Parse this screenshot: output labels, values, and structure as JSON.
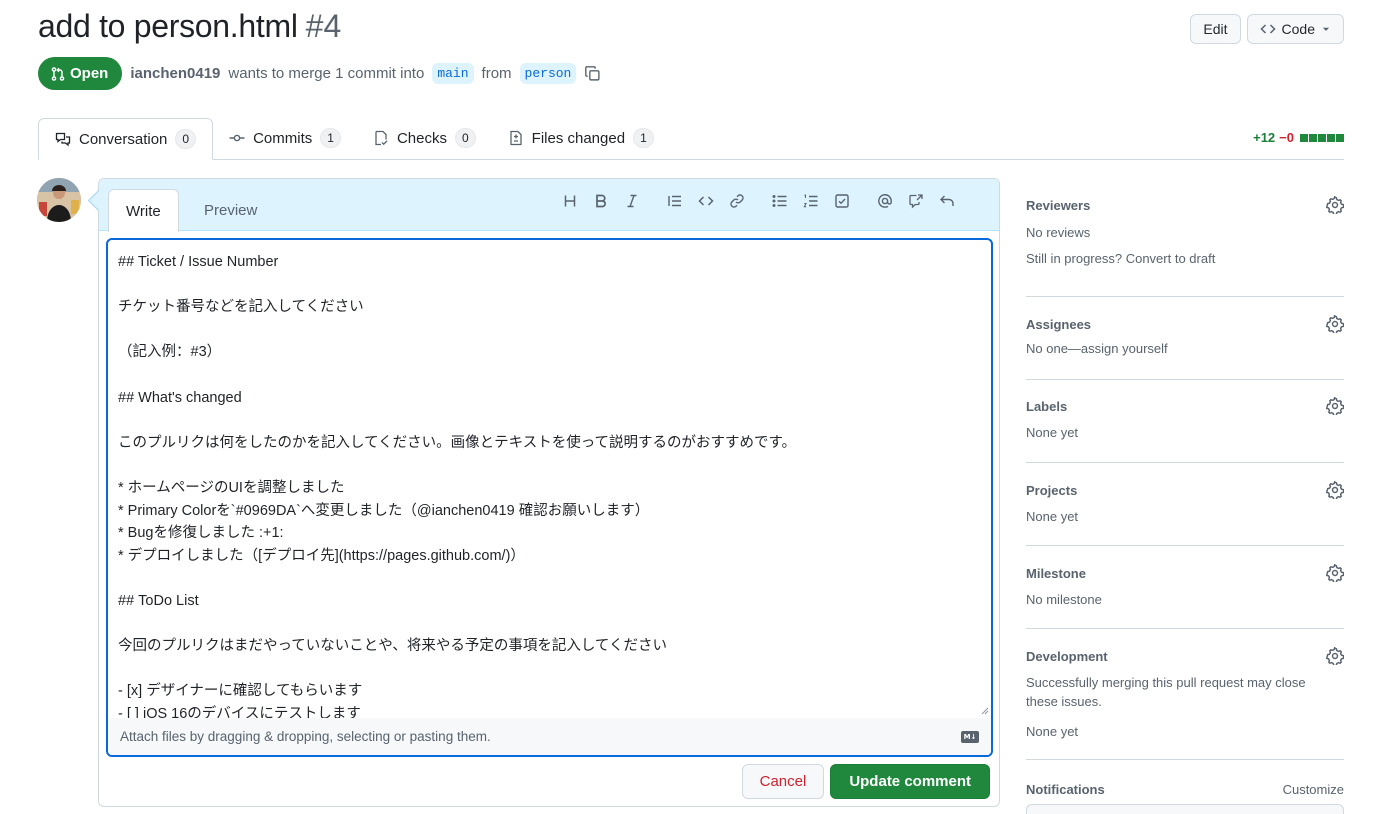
{
  "header": {
    "title": "add to person.html",
    "number": "#4",
    "edit_label": "Edit",
    "code_label": "Code"
  },
  "meta": {
    "state": "Open",
    "author": "ianchen0419",
    "merge_text": "wants to merge 1 commit into",
    "base_branch": "main",
    "from_text": "from",
    "head_branch": "person"
  },
  "tabs": [
    {
      "label": "Conversation",
      "count": "0",
      "icon": "comment-discussion-icon"
    },
    {
      "label": "Commits",
      "count": "1",
      "icon": "git-commit-icon"
    },
    {
      "label": "Checks",
      "count": "0",
      "icon": "checklist-icon"
    },
    {
      "label": "Files changed",
      "count": "1",
      "icon": "file-diff-icon"
    }
  ],
  "diffstat": {
    "additions": "+12",
    "deletions": "−0"
  },
  "editor": {
    "write_tab": "Write",
    "preview_tab": "Preview",
    "body": "## Ticket / Issue Number\n\nチケット番号などを記入してください\n\n（記入例：#3）\n\n## What's changed\n\nこのプルリクは何をしたのかを記入してください。画像とテキストを使って説明するのがおすすめです。\n\n* ホームページのUIを調整しました\n* Primary Colorを`#0969DA`へ変更しました（@ianchen0419 確認お願いします）\n* Bugを修復しました :+1:\n* デプロイしました（[デプロイ先](https://pages.github.com/)）\n\n## ToDo List\n\n今回のプルリクはまだやっていないことや、将来やる予定の事項を記入してください\n\n- [x] デザイナーに確認してもらいます\n- [ ] iOS 16のデバイスにテストします",
    "attach_hint": "Attach files by dragging & dropping, selecting or pasting them.",
    "markdown_badge": "M↓",
    "cancel_label": "Cancel",
    "update_label": "Update comment"
  },
  "sidebar": {
    "reviewers": {
      "title": "Reviewers",
      "line1": "No reviews",
      "line2": "Still in progress? Convert to draft"
    },
    "assignees": {
      "title": "Assignees",
      "line1": "No one—assign yourself"
    },
    "labels": {
      "title": "Labels",
      "line1": "None yet"
    },
    "projects": {
      "title": "Projects",
      "line1": "None yet"
    },
    "milestone": {
      "title": "Milestone",
      "line1": "No milestone"
    },
    "development": {
      "title": "Development",
      "line1": "Successfully merging this pull request may close these issues.",
      "line2": "None yet"
    },
    "notifications": {
      "title": "Notifications",
      "action": "Customize"
    }
  }
}
